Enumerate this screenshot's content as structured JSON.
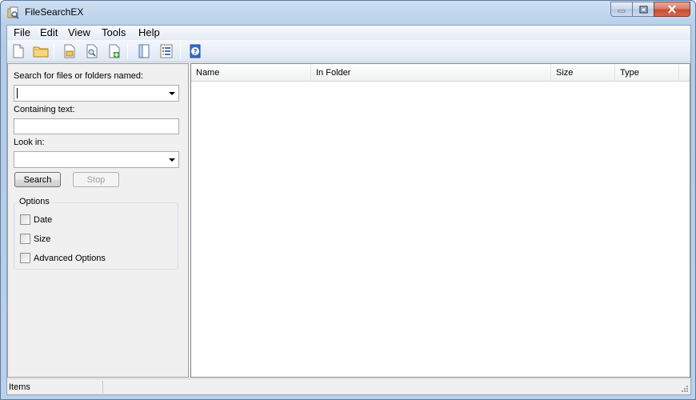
{
  "window": {
    "title": "FileSearchEX"
  },
  "menubar": {
    "items": [
      "File",
      "Edit",
      "View",
      "Tools",
      "Help"
    ]
  },
  "toolbar": {
    "buttons": [
      "new-file-icon",
      "open-folder-icon",
      "open-file-icon",
      "find-file-icon",
      "add-file-icon",
      "panel-view-icon",
      "details-view-icon",
      "help-icon"
    ]
  },
  "search": {
    "name_label": "Search for files or folders named:",
    "name_value": "",
    "containing_label": "Containing text:",
    "containing_value": "",
    "lookin_label": "Look in:",
    "lookin_value": "",
    "search_button": "Search",
    "stop_button": "Stop"
  },
  "options": {
    "title": "Options",
    "items": [
      {
        "label": "Date",
        "checked": false
      },
      {
        "label": "Size",
        "checked": false
      },
      {
        "label": "Advanced Options",
        "checked": false
      }
    ]
  },
  "results": {
    "columns": [
      "Name",
      "In Folder",
      "Size",
      "Type"
    ],
    "rows": []
  },
  "status": {
    "text": "Items"
  }
}
